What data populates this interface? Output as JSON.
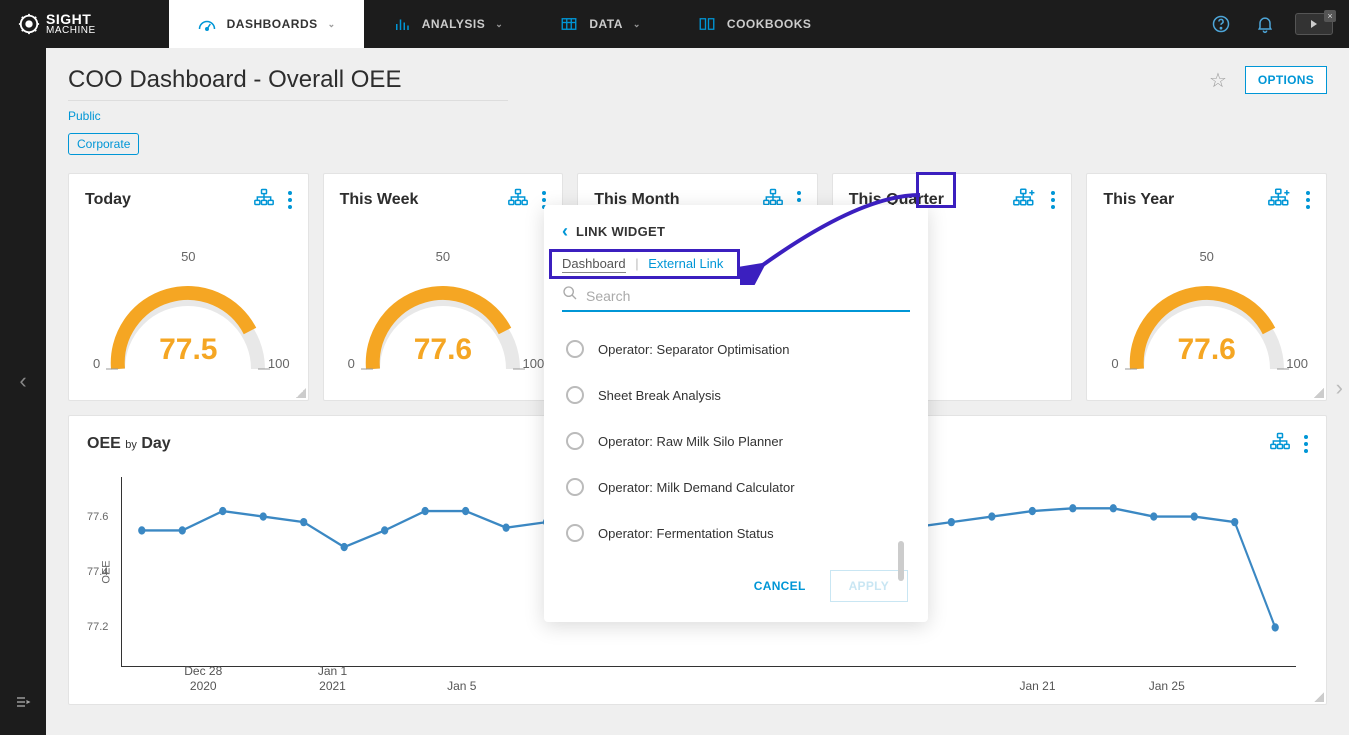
{
  "nav": {
    "brand_top": "SIGHT",
    "brand_bottom": "MACHINE",
    "items": [
      "DASHBOARDS",
      "ANALYSIS",
      "DATA",
      "COOKBOOKS"
    ]
  },
  "header": {
    "title": "COO Dashboard - Overall OEE",
    "public": "Public",
    "tag": "Corporate",
    "options": "OPTIONS"
  },
  "cards": [
    {
      "title": "Today",
      "value": "77.5",
      "min": "0",
      "mid": "50",
      "max": "100"
    },
    {
      "title": "This Week",
      "value": "77.6",
      "min": "0",
      "mid": "50",
      "max": "100"
    },
    {
      "title": "This Month",
      "value": "",
      "min": "",
      "mid": "",
      "max": ""
    },
    {
      "title": "This Quarter",
      "value": "",
      "min": "",
      "mid": "",
      "max": ""
    },
    {
      "title": "This Year",
      "value": "77.6",
      "min": "0",
      "mid": "50",
      "max": "100"
    }
  ],
  "chart": {
    "title_main": "OEE",
    "title_by": "by",
    "title_unit": "Day",
    "ylabel": "OEE"
  },
  "chart_data": {
    "type": "line",
    "ylabel": "OEE",
    "ylim": [
      77.1,
      77.7
    ],
    "yticks": [
      77.2,
      77.4,
      77.6
    ],
    "x_labels": [
      "Dec 28 2020",
      "Jan 1 2021",
      "Jan 5",
      "Jan 21",
      "Jan 25"
    ],
    "series": [
      {
        "name": "OEE",
        "color": "#3b88c3",
        "values": [
          77.55,
          77.55,
          77.62,
          77.6,
          77.58,
          77.49,
          77.55,
          77.62,
          77.62,
          77.56,
          77.58,
          77.58,
          77.58,
          77.55,
          77.6,
          77.55,
          77.55,
          77.58,
          77.6,
          77.56,
          77.58,
          77.6,
          77.62,
          77.63,
          77.63,
          77.6,
          77.6,
          77.58,
          77.2
        ]
      }
    ]
  },
  "popup": {
    "title": "LINK WIDGET",
    "tab_dashboard": "Dashboard",
    "tab_external": "External Link",
    "search_placeholder": "Search",
    "options": [
      "Operator: Separator Optimisation",
      "Sheet Break Analysis",
      "Operator: Raw Milk Silo Planner",
      "Operator: Milk Demand Calculator",
      "Operator: Fermentation Status"
    ],
    "cancel": "CANCEL",
    "apply": "APPLY"
  }
}
